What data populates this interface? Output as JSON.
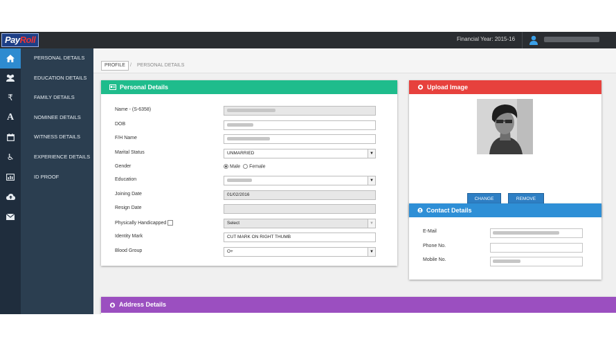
{
  "topbar": {
    "logo_pay": "Pay",
    "logo_roll": "Roll",
    "financial_year": "Financial Year: 2015-16",
    "colors": {
      "bar": "#2a2d31",
      "accent": "#2e8bd0"
    }
  },
  "iconbar": {
    "items": [
      {
        "icon": "home-icon",
        "active": true
      },
      {
        "icon": "users-icon"
      },
      {
        "icon": "rupee-icon",
        "glyph": "₹"
      },
      {
        "icon": "font-a-icon",
        "glyph": "A"
      },
      {
        "icon": "calendar-icon"
      },
      {
        "icon": "wheelchair-icon",
        "glyph": "♿"
      },
      {
        "icon": "bar-chart-icon"
      },
      {
        "icon": "cloud-upload-icon"
      },
      {
        "icon": "envelope-icon"
      }
    ]
  },
  "submenu": {
    "items": [
      {
        "label": "PERSONAL DETAILS"
      },
      {
        "label": "EDUCATION DETAILS"
      },
      {
        "label": "FAMILY DETAILS"
      },
      {
        "label": "NOMINEE DETAILS"
      },
      {
        "label": "WITNESS DETAILS"
      },
      {
        "label": "EXPERIENCE DETAILS"
      },
      {
        "label": "ID PROOF"
      }
    ]
  },
  "breadcrumb": {
    "root": "PROFILE",
    "separator": "/",
    "current": "PERSONAL DETAILS"
  },
  "personal": {
    "title": "Personal Details",
    "fields": {
      "name_label": "Name - (S-6358)",
      "dob_label": "DOB",
      "father_label": "F/H Name",
      "marital_label": "Marital Status",
      "marital_value": "UNMARRIED",
      "gender_label": "Gender",
      "gender_male": "Male",
      "gender_female": "Female",
      "gender_selected": "Male",
      "education_label": "Education",
      "joining_label": "Joining Date",
      "joining_value": "01/02/2016",
      "resign_label": "Resign Date",
      "handicapped_label": "Physically Handicapped",
      "handicapped_value": "Select",
      "identity_label": "Identity Mark",
      "identity_value": "CUT MARK ON RIGHT THUMB",
      "blood_label": "Blood Group",
      "blood_value": "O+"
    }
  },
  "upload": {
    "title": "Upload Image",
    "change_label": "CHANGE",
    "remove_label": "REMOVE"
  },
  "contact": {
    "title": "Contact Details",
    "email_label": "E-Mail",
    "phone_label": "Phone No.",
    "mobile_label": "Mobile No."
  },
  "address": {
    "title": "Address Details"
  }
}
